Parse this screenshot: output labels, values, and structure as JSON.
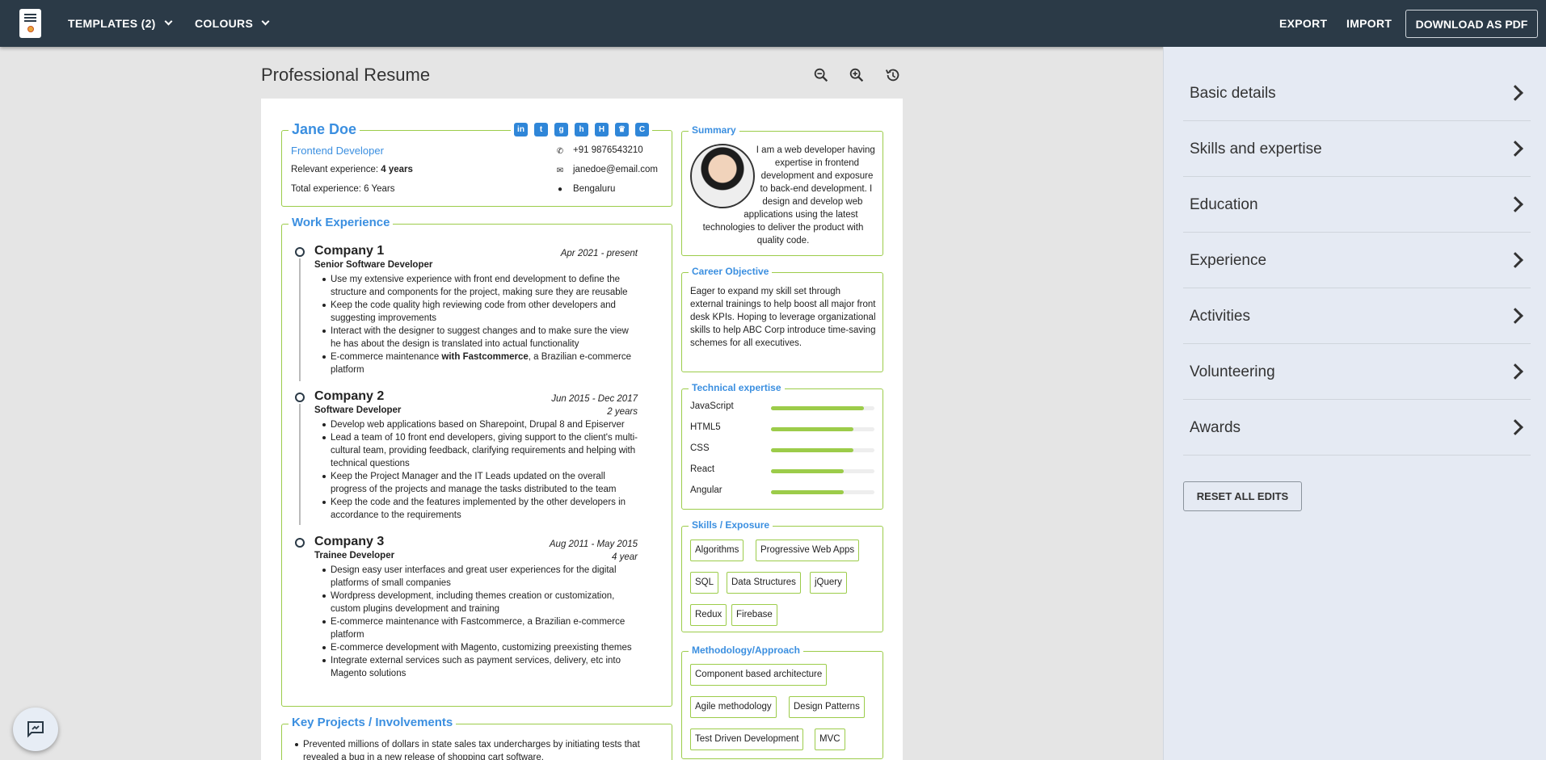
{
  "topbar": {
    "templates": "TEMPLATES (2)",
    "colours": "COLOURS",
    "export": "EXPORT",
    "import": "IMPORT",
    "download": "DOWNLOAD AS PDF"
  },
  "page_title": "Professional Resume",
  "resume": {
    "name": "Jane Doe",
    "title": "Frontend Developer",
    "relevant_label": "Relevant experience:",
    "relevant_value": "4 years",
    "total_exp": "Total experience: 6 Years",
    "phone": "+91 9876543210",
    "email": "janedoe@email.com",
    "location": "Bengaluru",
    "social_icons": [
      "linkedin-icon",
      "twitter-icon",
      "github-icon",
      "hashnode-icon",
      "hackerrank-icon",
      "crown-icon",
      "codechef-icon"
    ],
    "work_heading": "Work Experience",
    "companies": [
      {
        "name": "Company 1",
        "date": "Apr 2021 - present",
        "duration": "",
        "role": "Senior Software Developer",
        "bullets": [
          "Use my extensive experience with front end development to define the structure and components for the project, making sure they are reusable",
          "Keep the code quality high reviewing code from other developers and suggesting improvements",
          "Interact with the designer to suggest changes and to make sure the view he has about the design is translated into actual functionality"
        ],
        "last_pre": "E-commerce maintenance ",
        "last_bold": "with Fastcommerce",
        "last_post": ", a Brazilian e-commerce platform"
      },
      {
        "name": "Company 2",
        "date": "Jun 2015 - Dec 2017",
        "duration": "2 years",
        "role": "Software Developer",
        "bullets": [
          "Develop web applications based on Sharepoint, Drupal 8 and Episerver",
          "Lead a team of 10 front end developers, giving support to the client's multi-cultural team, providing feedback, clarifying requirements and helping with technical questions",
          "Keep the Project Manager and the IT Leads updated on the overall progress of the projects and manage the tasks distributed to the team",
          "Keep the code and the features implemented by the other developers in accordance to the requirements"
        ]
      },
      {
        "name": "Company 3",
        "date": "Aug 2011 - May 2015",
        "duration": "4 year",
        "role": "Trainee Developer",
        "bullets": [
          "Design easy user interfaces and great user experiences for the digital platforms of small companies",
          "Wordpress development, including themes creation or customization, custom plugins development and training",
          "E-commerce maintenance with Fastcommerce, a Brazilian e-commerce platform",
          "E-commerce development with Magento, customizing preexisting themes",
          "Integrate external services such as payment services, delivery, etc into Magento solutions"
        ]
      }
    ],
    "projects_heading": "Key Projects / Involvements",
    "projects": [
      "Prevented millions of dollars in state sales tax undercharges by initiating tests that revealed a bug in a new release of shopping cart software."
    ],
    "summary_heading": "Summary",
    "summary": "I am a web developer having expertise in frontend development and exposure to back-end development. I design and develop web applications using the latest technologies to deliver the product with quality code.",
    "objective_heading": "Career Objective",
    "objective": "Eager to expand my skill set through external trainings to help boost all major front desk KPIs. Hoping to leverage organizational skills to help ABC Corp introduce time-saving schemes for all executives.",
    "tech_heading": "Technical expertise",
    "tech": [
      {
        "name": "JavaScript",
        "level": 0.9
      },
      {
        "name": "HTML5",
        "level": 0.8
      },
      {
        "name": "CSS",
        "level": 0.8
      },
      {
        "name": "React",
        "level": 0.7
      },
      {
        "name": "Angular",
        "level": 0.7
      }
    ],
    "skills_heading": "Skills / Exposure",
    "skills": [
      "Algorithms",
      "Progressive Web Apps",
      "SQL",
      "Data Structures",
      "jQuery",
      "Redux",
      "Firebase"
    ],
    "method_heading": "Methodology/Approach",
    "methods": [
      "Component based architecture",
      "Agile methodology",
      "Design Patterns",
      "Test Driven Development",
      "MVC"
    ]
  },
  "sidebar": {
    "items": [
      "Basic details",
      "Skills and expertise",
      "Education",
      "Experience",
      "Activities",
      "Volunteering",
      "Awards"
    ],
    "reset": "RESET ALL EDITS"
  },
  "colors": {
    "accent": "#3b8fe0",
    "border": "#9ccc4a",
    "topbar": "#2b3a47"
  }
}
